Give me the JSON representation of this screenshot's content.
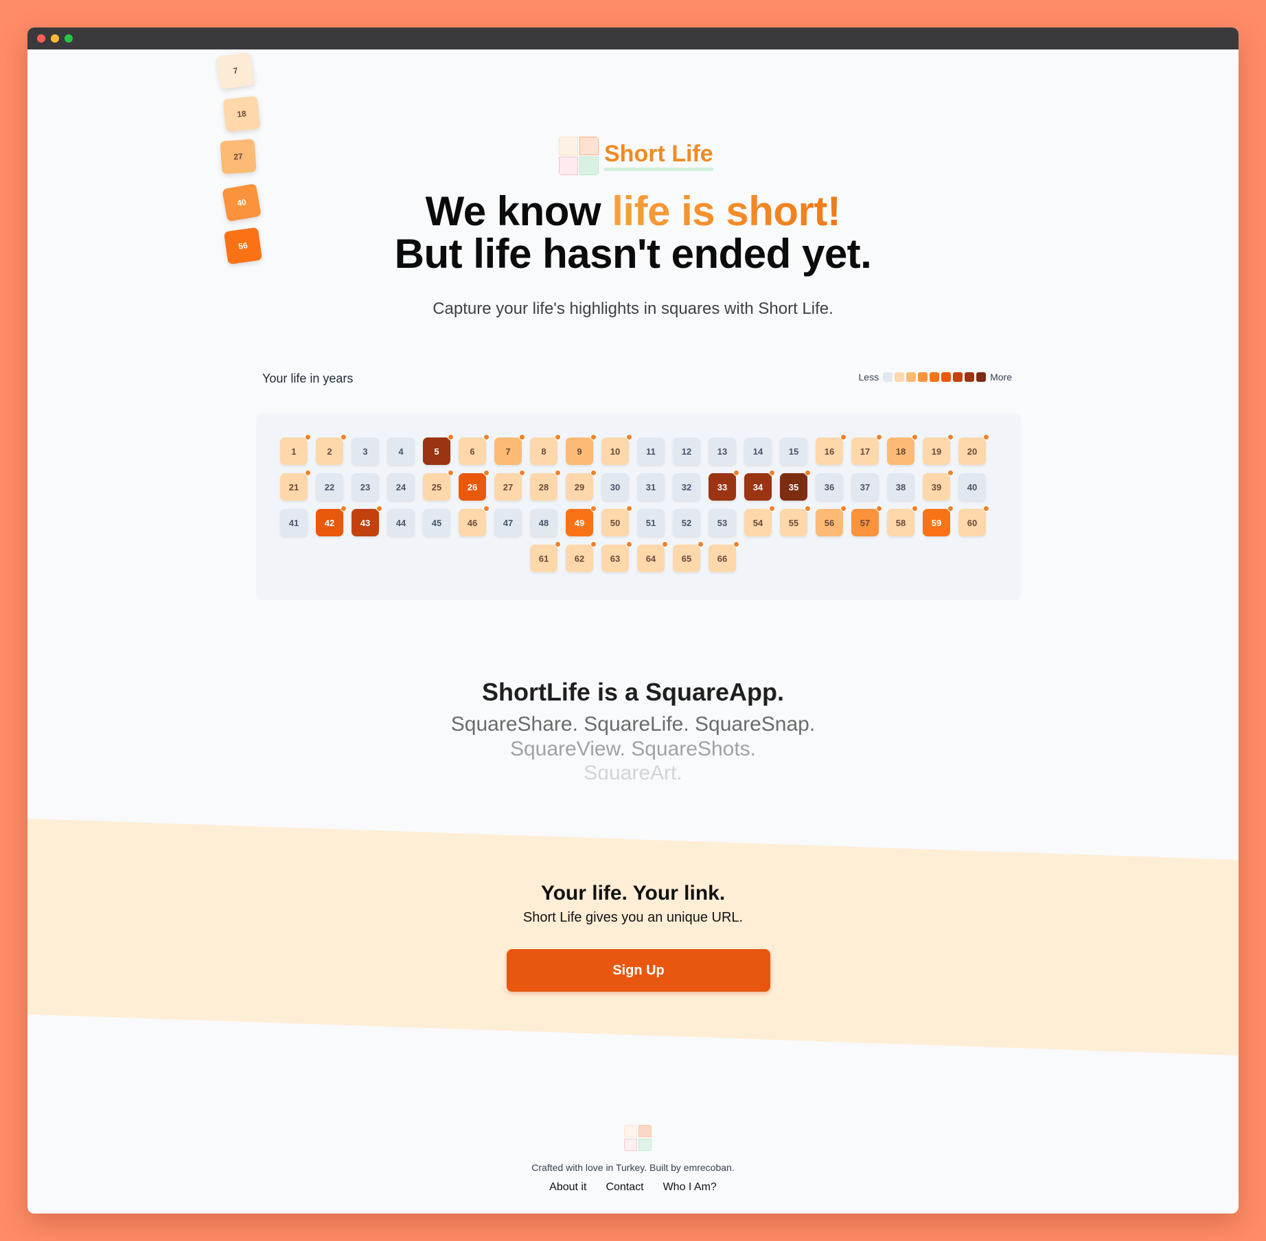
{
  "colors": {
    "accent": "#f08a24",
    "button": "#e8560f",
    "band": "#ffeed6",
    "empty": "#e2e8f0",
    "levels": [
      "#e2e8f0",
      "#fed7aa",
      "#fdba74",
      "#fb923c",
      "#f97316",
      "#ea580c",
      "#c2410c",
      "#9a3412",
      "#7c2d12"
    ]
  },
  "logo": {
    "text": "Short Life"
  },
  "headline": {
    "part1": "We know ",
    "accent": "life is short!",
    "line2": "But life hasn't ended yet."
  },
  "subtitle": "Capture your life's highlights in squares with Short Life.",
  "grid": {
    "label": "Your life in years",
    "legend_less": "Less",
    "legend_more": "More",
    "cells": [
      {
        "n": "1",
        "lvl": 1,
        "mk": true
      },
      {
        "n": "2",
        "lvl": 1,
        "mk": true
      },
      {
        "n": "3",
        "lvl": 0,
        "mk": false
      },
      {
        "n": "4",
        "lvl": 0,
        "mk": false
      },
      {
        "n": "5",
        "lvl": 7,
        "mk": true
      },
      {
        "n": "6",
        "lvl": 1,
        "mk": true
      },
      {
        "n": "7",
        "lvl": 2,
        "mk": true
      },
      {
        "n": "8",
        "lvl": 1,
        "mk": true
      },
      {
        "n": "9",
        "lvl": 2,
        "mk": true
      },
      {
        "n": "10",
        "lvl": 1,
        "mk": true
      },
      {
        "n": "11",
        "lvl": 0,
        "mk": false
      },
      {
        "n": "12",
        "lvl": 0,
        "mk": false
      },
      {
        "n": "13",
        "lvl": 0,
        "mk": false
      },
      {
        "n": "14",
        "lvl": 0,
        "mk": false
      },
      {
        "n": "15",
        "lvl": 0,
        "mk": false
      },
      {
        "n": "16",
        "lvl": 1,
        "mk": true
      },
      {
        "n": "17",
        "lvl": 1,
        "mk": true
      },
      {
        "n": "18",
        "lvl": 2,
        "mk": true
      },
      {
        "n": "19",
        "lvl": 1,
        "mk": true
      },
      {
        "n": "20",
        "lvl": 1,
        "mk": true
      },
      {
        "n": "21",
        "lvl": 1,
        "mk": true
      },
      {
        "n": "22",
        "lvl": 0,
        "mk": false
      },
      {
        "n": "23",
        "lvl": 0,
        "mk": false
      },
      {
        "n": "24",
        "lvl": 0,
        "mk": false
      },
      {
        "n": "25",
        "lvl": 1,
        "mk": true
      },
      {
        "n": "26",
        "lvl": 5,
        "mk": true
      },
      {
        "n": "27",
        "lvl": 1,
        "mk": true
      },
      {
        "n": "28",
        "lvl": 1,
        "mk": true
      },
      {
        "n": "29",
        "lvl": 1,
        "mk": true
      },
      {
        "n": "30",
        "lvl": 0,
        "mk": false
      },
      {
        "n": "31",
        "lvl": 0,
        "mk": false
      },
      {
        "n": "32",
        "lvl": 0,
        "mk": false
      },
      {
        "n": "33",
        "lvl": 7,
        "mk": true
      },
      {
        "n": "34",
        "lvl": 7,
        "mk": true
      },
      {
        "n": "35",
        "lvl": 8,
        "mk": true
      },
      {
        "n": "36",
        "lvl": 0,
        "mk": false
      },
      {
        "n": "37",
        "lvl": 0,
        "mk": false
      },
      {
        "n": "38",
        "lvl": 0,
        "mk": false
      },
      {
        "n": "39",
        "lvl": 1,
        "mk": true
      },
      {
        "n": "40",
        "lvl": 0,
        "mk": false
      },
      {
        "n": "41",
        "lvl": 0,
        "mk": false
      },
      {
        "n": "42",
        "lvl": 5,
        "mk": true
      },
      {
        "n": "43",
        "lvl": 6,
        "mk": true
      },
      {
        "n": "44",
        "lvl": 0,
        "mk": false
      },
      {
        "n": "45",
        "lvl": 0,
        "mk": false
      },
      {
        "n": "46",
        "lvl": 1,
        "mk": true
      },
      {
        "n": "47",
        "lvl": 0,
        "mk": false
      },
      {
        "n": "48",
        "lvl": 0,
        "mk": false
      },
      {
        "n": "49",
        "lvl": 4,
        "mk": true
      },
      {
        "n": "50",
        "lvl": 1,
        "mk": true
      },
      {
        "n": "51",
        "lvl": 0,
        "mk": false
      },
      {
        "n": "52",
        "lvl": 0,
        "mk": false
      },
      {
        "n": "53",
        "lvl": 0,
        "mk": false
      },
      {
        "n": "54",
        "lvl": 1,
        "mk": true
      },
      {
        "n": "55",
        "lvl": 1,
        "mk": true
      },
      {
        "n": "56",
        "lvl": 2,
        "mk": true
      },
      {
        "n": "57",
        "lvl": 3,
        "mk": true
      },
      {
        "n": "58",
        "lvl": 1,
        "mk": true
      },
      {
        "n": "59",
        "lvl": 4,
        "mk": true
      },
      {
        "n": "60",
        "lvl": 1,
        "mk": true
      },
      {
        "n": "61",
        "lvl": 1,
        "mk": true
      },
      {
        "n": "62",
        "lvl": 1,
        "mk": true
      },
      {
        "n": "63",
        "lvl": 1,
        "mk": true
      },
      {
        "n": "64",
        "lvl": 1,
        "mk": true
      },
      {
        "n": "65",
        "lvl": 1,
        "mk": true
      },
      {
        "n": "66",
        "lvl": 1,
        "mk": true
      }
    ]
  },
  "floating_tiles": [
    {
      "n": "7",
      "lvl": "#fdebd5",
      "rot": -8
    },
    {
      "n": "18",
      "lvl": "#fed7aa",
      "rot": -6
    },
    {
      "n": "27",
      "lvl": "#fdba74",
      "rot": -4
    },
    {
      "n": "40",
      "lvl": "#fb923c",
      "rot": -10
    },
    {
      "n": "56",
      "lvl": "#f97316",
      "rot": -8
    }
  ],
  "squareapp": {
    "title": "ShortLife is a SquareApp.",
    "line1": "SquareShare. SquareLife. SquareSnap.",
    "line2": "SquareView. SquareShots.",
    "line3": "SquareArt."
  },
  "band": {
    "title": "Your life. Your link.",
    "subtitle": "Short Life gives you an unique URL.",
    "button": "Sign Up"
  },
  "footer": {
    "text": "Crafted with love in Turkey. Built by emrecoban.",
    "links": [
      "About it",
      "Contact",
      "Who I Am?"
    ]
  }
}
